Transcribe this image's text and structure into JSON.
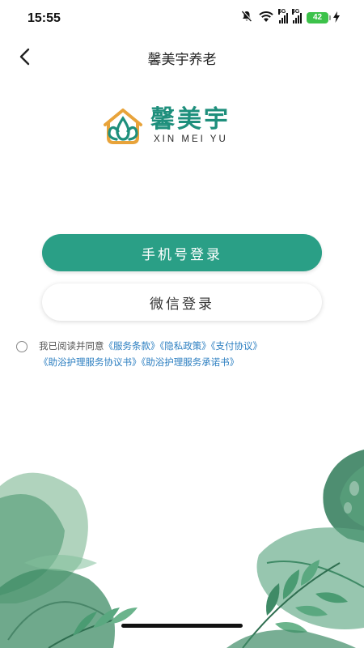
{
  "status_bar": {
    "time": "15:55",
    "network_1": "5G",
    "network_2": "5G",
    "battery": "42",
    "icons": [
      "mute-icon",
      "wifi-icon",
      "signal-icon",
      "signal-icon",
      "battery-icon",
      "charging-icon"
    ]
  },
  "nav": {
    "title": "馨美宇养老",
    "back_icon": "chevron-left-icon"
  },
  "logo": {
    "name_cn": "馨美宇",
    "name_en": "XIN MEI YU"
  },
  "buttons": {
    "phone_login": "手机号登录",
    "wechat_login": "微信登录"
  },
  "agreement": {
    "prefix": "我已阅读并同意",
    "links": [
      "《服务条款》",
      "《隐私政策》",
      "《支付协议》",
      "《助浴护理服务协议书》",
      "《助浴护理服务承诺书》"
    ],
    "checked": false
  },
  "colors": {
    "primary": "#2a9f86",
    "logo_green": "#1e8f7c",
    "logo_orange": "#e8a33a",
    "link": "#2d7fc1"
  }
}
